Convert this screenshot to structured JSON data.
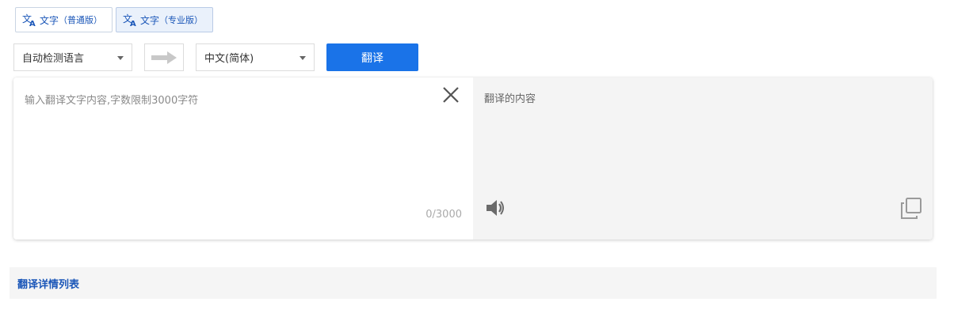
{
  "tabs": [
    {
      "main": "文字",
      "sub": "（普通版）",
      "active": false
    },
    {
      "main": "文字",
      "sub": "（专业版）",
      "active": true
    }
  ],
  "toolbar": {
    "source_lang": "自动检测语言",
    "target_lang": "中文(简体)",
    "translate_label": "翻译"
  },
  "editor": {
    "placeholder": "输入翻译文字内容,字数限制3000字符",
    "value": "",
    "counter": "0/3000"
  },
  "output": {
    "text": "翻译的内容"
  },
  "details": {
    "title": "翻译详情列表"
  },
  "icons": {
    "translate": "translate-icon",
    "arrow": "arrow-right-icon",
    "close": "close-icon",
    "speaker": "speaker-icon",
    "copy": "copy-icon"
  },
  "colors": {
    "accent": "#1a73e8",
    "link": "#1a56b8",
    "output_bg": "#f4f4f4"
  }
}
